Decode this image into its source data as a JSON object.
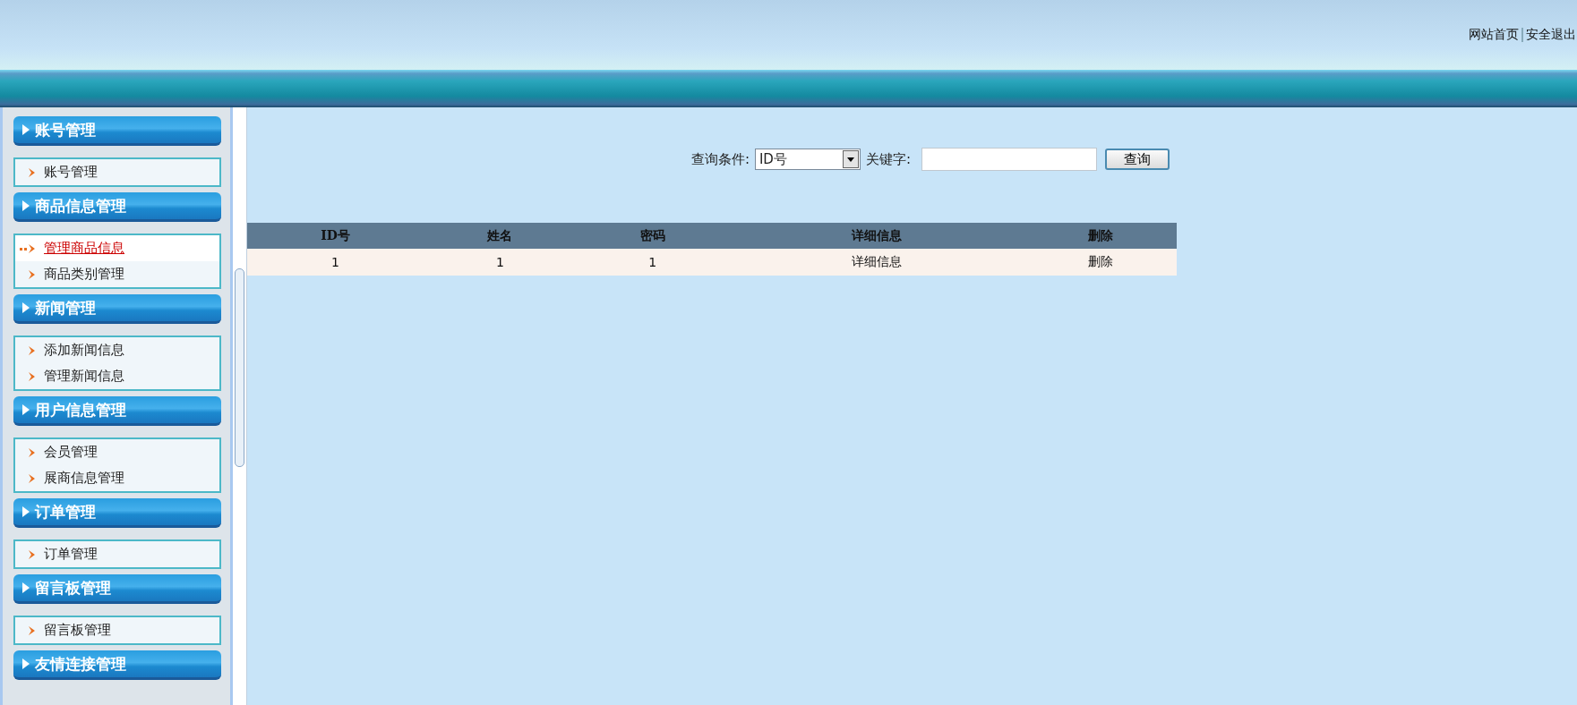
{
  "top_links": [
    "网站首页",
    "安全退出"
  ],
  "sidebar": {
    "groups": [
      {
        "title": "账号管理",
        "items": [
          {
            "label": "账号管理",
            "selected": false
          }
        ]
      },
      {
        "title": "商品信息管理",
        "items": [
          {
            "label": "管理商品信息",
            "selected": true
          },
          {
            "label": "商品类别管理",
            "selected": false
          }
        ]
      },
      {
        "title": "新闻管理",
        "items": [
          {
            "label": "添加新闻信息",
            "selected": false
          },
          {
            "label": "管理新闻信息",
            "selected": false
          }
        ]
      },
      {
        "title": "用户信息管理",
        "items": [
          {
            "label": "会员管理",
            "selected": false
          },
          {
            "label": "展商信息管理",
            "selected": false
          }
        ]
      },
      {
        "title": "订单管理",
        "items": [
          {
            "label": "订单管理",
            "selected": false
          }
        ]
      },
      {
        "title": "留言板管理",
        "items": [
          {
            "label": "留言板管理",
            "selected": false
          }
        ]
      },
      {
        "title": "友情连接管理"
      }
    ]
  },
  "search": {
    "condition_label": "查询条件:",
    "condition_value": "ID号",
    "keyword_label": "关键字:",
    "button": "查询"
  },
  "table": {
    "columns": [
      "ID号",
      "姓名",
      "密码",
      "详细信息",
      "删除"
    ],
    "rows": [
      [
        "1",
        "1",
        "1",
        "详细信息",
        "删除"
      ]
    ]
  }
}
